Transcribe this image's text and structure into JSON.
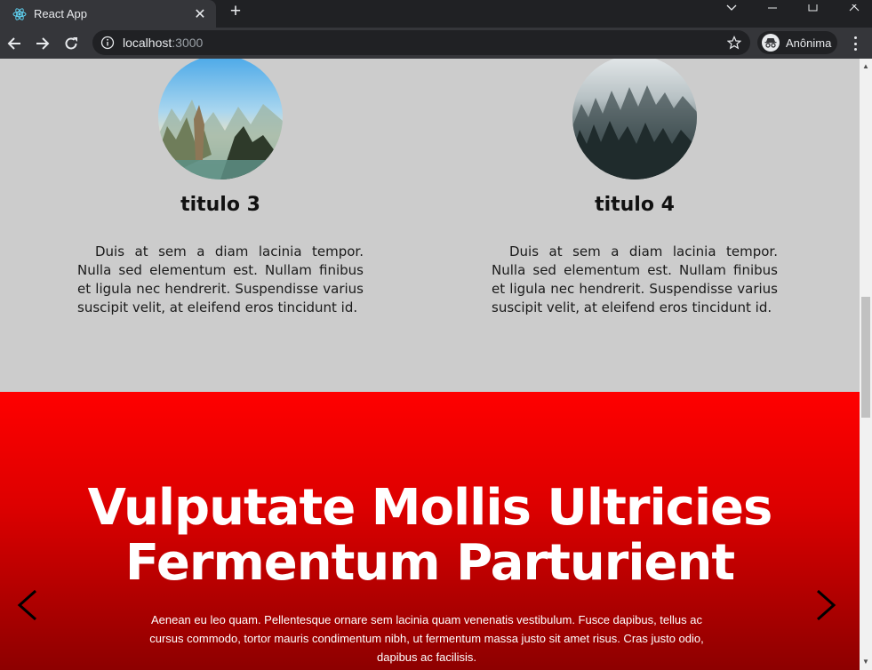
{
  "browser": {
    "tab_title": "React App",
    "url_host": "localhost",
    "url_port": ":3000",
    "profile_name": "Anônima"
  },
  "cards": [
    {
      "title": "titulo 3",
      "text": "Duis at sem a diam lacinia tempor. Nulla sed elementum est. Nullam finibus et ligula nec hendrerit. Suspendisse varius suscipit velit, at eleifend eros tincidunt id.",
      "image": "mountain-lake-photo"
    },
    {
      "title": "titulo 4",
      "text": "Duis at sem a diam lacinia tempor. Nulla sed elementum est. Nullam finibus et ligula nec hendrerit. Suspendisse varius suscipit velit, at eleifend eros tincidunt id.",
      "image": "foggy-forest-photo"
    }
  ],
  "carousel": {
    "title_line1": "Vulputate Mollis Ultricies",
    "title_line2": "Fermentum Parturient",
    "text": "Aenean eu leo quam. Pellentesque ornare sem lacinia quam venenatis vestibulum. Fusce dapibus, tellus ac cursus commodo, tortor mauris condimentum nibh, ut fermentum massa justo sit amet risus. Cras justo odio, dapibus ac facilisis.",
    "prev_icon": "chevron-left-icon",
    "next_icon": "chevron-right-icon"
  },
  "colors": {
    "page_bg": "#cccccc",
    "banner_top": "#ff0000",
    "banner_bottom": "#8a0000",
    "chrome_dark": "#202124",
    "chrome_toolbar": "#35363a"
  }
}
